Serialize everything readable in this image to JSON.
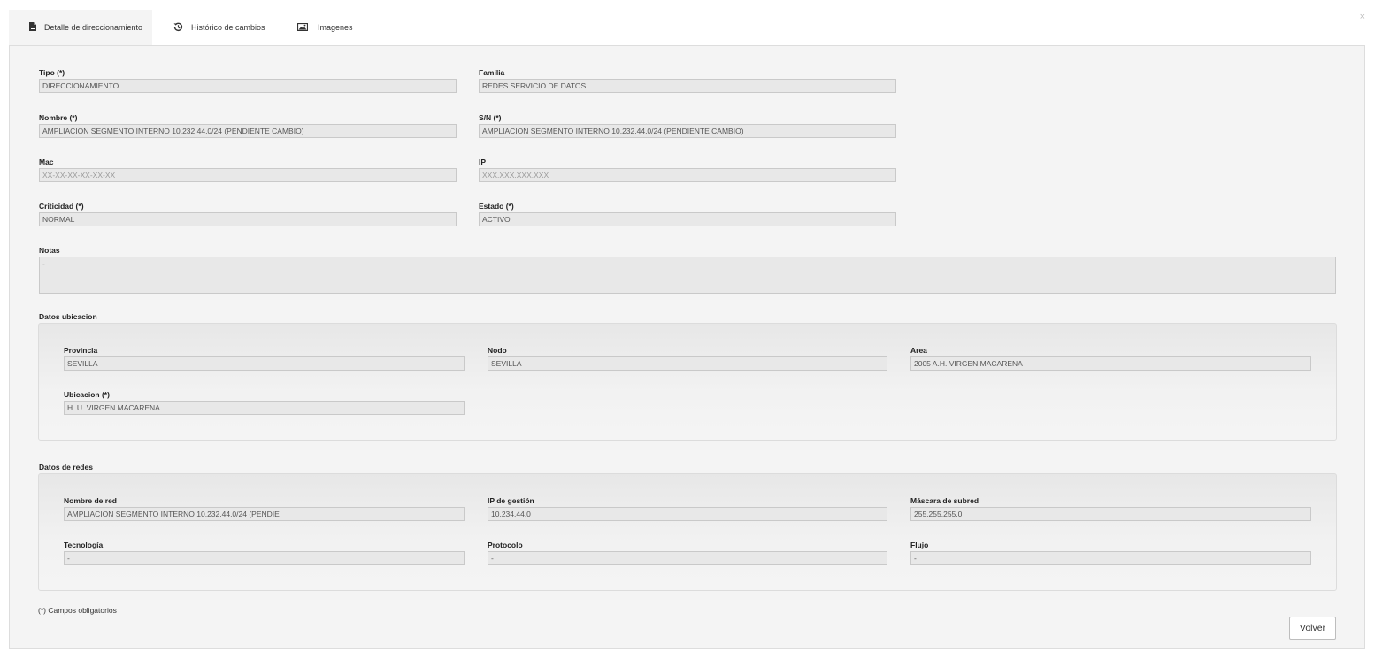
{
  "tabs": [
    {
      "label": "Detalle de direccionamiento",
      "icon": "document-icon",
      "active": true
    },
    {
      "label": "Histórico de cambios",
      "icon": "history-icon",
      "active": false
    },
    {
      "label": "Imagenes",
      "icon": "image-icon",
      "active": false
    }
  ],
  "close_label": "×",
  "fields": {
    "tipo": {
      "label": "Tipo (*)",
      "value": "DIRECCIONAMIENTO"
    },
    "familia": {
      "label": "Familia",
      "value": "REDES.SERVICIO DE DATOS"
    },
    "nombre": {
      "label": "Nombre (*)",
      "value": "AMPLIACION SEGMENTO INTERNO 10.232.44.0/24 (PENDIENTE CAMBIO)"
    },
    "sn": {
      "label": "S/N (*)",
      "value": "AMPLIACION SEGMENTO INTERNO 10.232.44.0/24 (PENDIENTE CAMBIO)"
    },
    "mac": {
      "label": "Mac",
      "placeholder": "XX-XX-XX-XX-XX-XX"
    },
    "ip": {
      "label": "IP",
      "placeholder": "XXX.XXX.XXX.XXX"
    },
    "criticidad": {
      "label": "Criticidad (*)",
      "value": "NORMAL"
    },
    "estado": {
      "label": "Estado (*)",
      "value": "ACTIVO"
    },
    "notas": {
      "label": "Notas",
      "value": "-"
    }
  },
  "ubicacion": {
    "title": "Datos ubicacion",
    "provincia": {
      "label": "Provincia",
      "value": "SEVILLA"
    },
    "nodo": {
      "label": "Nodo",
      "value": "SEVILLA"
    },
    "area": {
      "label": "Area",
      "value": "2005 A.H. VIRGEN MACARENA"
    },
    "ubicacion": {
      "label": "Ubicacion (*)",
      "value": "H. U. VIRGEN MACARENA"
    }
  },
  "redes": {
    "title": "Datos de redes",
    "nombre_red": {
      "label": "Nombre de red",
      "value": "AMPLIACION SEGMENTO INTERNO 10.232.44.0/24 (PENDIE"
    },
    "ip_gestion": {
      "label": "IP de gestión",
      "value": "10.234.44.0"
    },
    "mascara": {
      "label": "Máscara de subred",
      "value": "255.255.255.0"
    },
    "tecnologia": {
      "label": "Tecnología",
      "value": "-"
    },
    "protocolo": {
      "label": "Protocolo",
      "value": "-"
    },
    "flujo": {
      "label": "Flujo",
      "value": "-"
    }
  },
  "footnote": "(*) Campos obligatorios",
  "back_button": "Volver"
}
